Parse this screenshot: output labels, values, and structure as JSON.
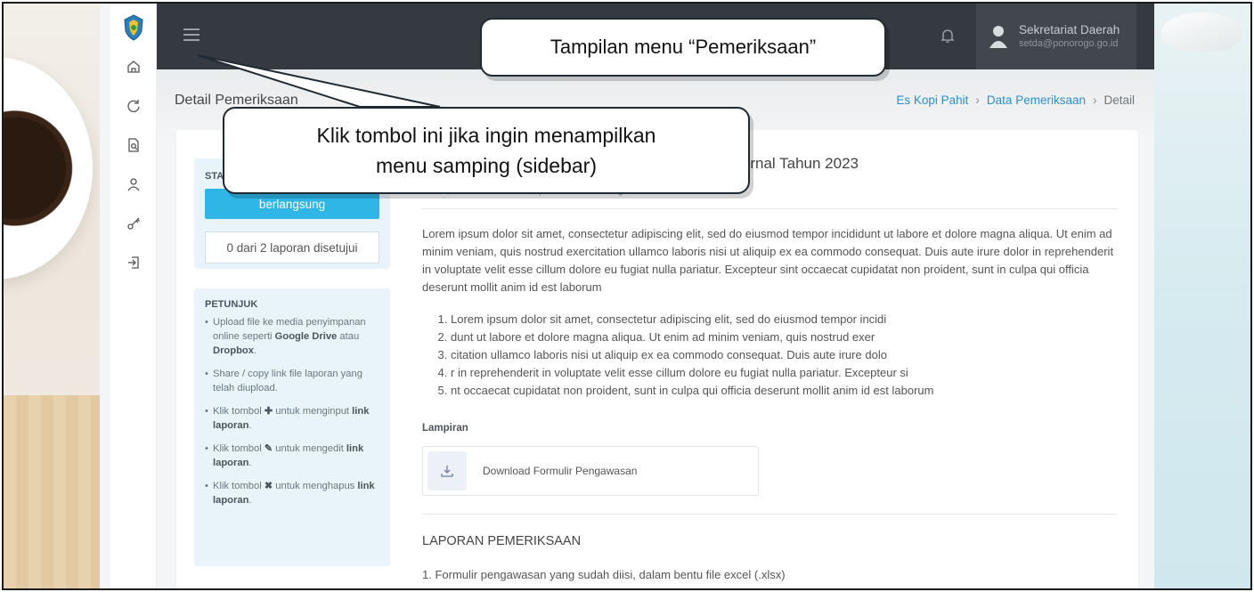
{
  "colors": {
    "topbar": "#343a40",
    "accent_blue": "#2fb5e6",
    "link_blue": "#2d8fd0",
    "info_box": "#e8f4fa"
  },
  "sidebar": {
    "items": [
      {
        "icon": "home-icon"
      },
      {
        "icon": "refresh-icon"
      },
      {
        "icon": "document-search-icon"
      },
      {
        "icon": "user-icon"
      },
      {
        "icon": "key-icon"
      },
      {
        "icon": "logout-icon"
      }
    ]
  },
  "topbar": {
    "user_name": "Sekretariat Daerah",
    "user_email": "setda@ponorogo.go.id"
  },
  "page": {
    "title": "Detail Pemeriksaan",
    "breadcrumb": [
      "Es Kopi Pahit",
      "Data Pemeriksaan",
      "Detail"
    ]
  },
  "status": {
    "label": "STA",
    "button_label": "berlangsung",
    "approved_text": "0 dari 2 laporan disetujui"
  },
  "hints": {
    "title": "PETUNJUK"
  },
  "detail": {
    "title_suffix": "Internal Tahun 2023",
    "meta": "Senin, 20 November 2023 | oleh Sunarti Aningsih",
    "paragraph": "Lorem ipsum dolor sit amet, consectetur adipiscing elit, sed do eiusmod tempor incididunt ut labore et dolore magna aliqua. Ut enim ad minim veniam, quis nostrud exercitation ullamco laboris nisi ut aliquip ex ea commodo consequat. Duis aute irure dolor in reprehenderit in voluptate velit esse cillum dolore eu fugiat nulla pariatur. Excepteur sint occaecat cupidatat non proident, sunt in culpa qui officia deserunt mollit anim id est laborum",
    "list": [
      "Lorem ipsum dolor sit amet, consectetur adipiscing elit, sed do eiusmod tempor incidi",
      "dunt ut labore et dolore magna aliqua. Ut enim ad minim veniam, quis nostrud exer",
      "citation ullamco laboris nisi ut aliquip ex ea commodo consequat. Duis aute irure dolo",
      "r in reprehenderit in voluptate velit esse cillum dolore eu fugiat nulla pariatur. Excepteur si",
      "nt occaecat cupidatat non proident, sunt in culpa qui officia deserunt mollit anim id est laborum"
    ],
    "attachment_label": "Lampiran",
    "attachment_name": "Download Formulir Pengawasan",
    "report_heading": "LAPORAN PEMERIKSAAN",
    "question": "1. Formulir pengawasan yang sudah diisi, dalam bentu file excel (.xlsx)"
  },
  "callouts": {
    "top": "Tampilan menu “Pemeriksaan”",
    "mid_line1": "Klik tombol ini jika ingin menampilkan",
    "mid_line2": "menu samping (sidebar)"
  }
}
